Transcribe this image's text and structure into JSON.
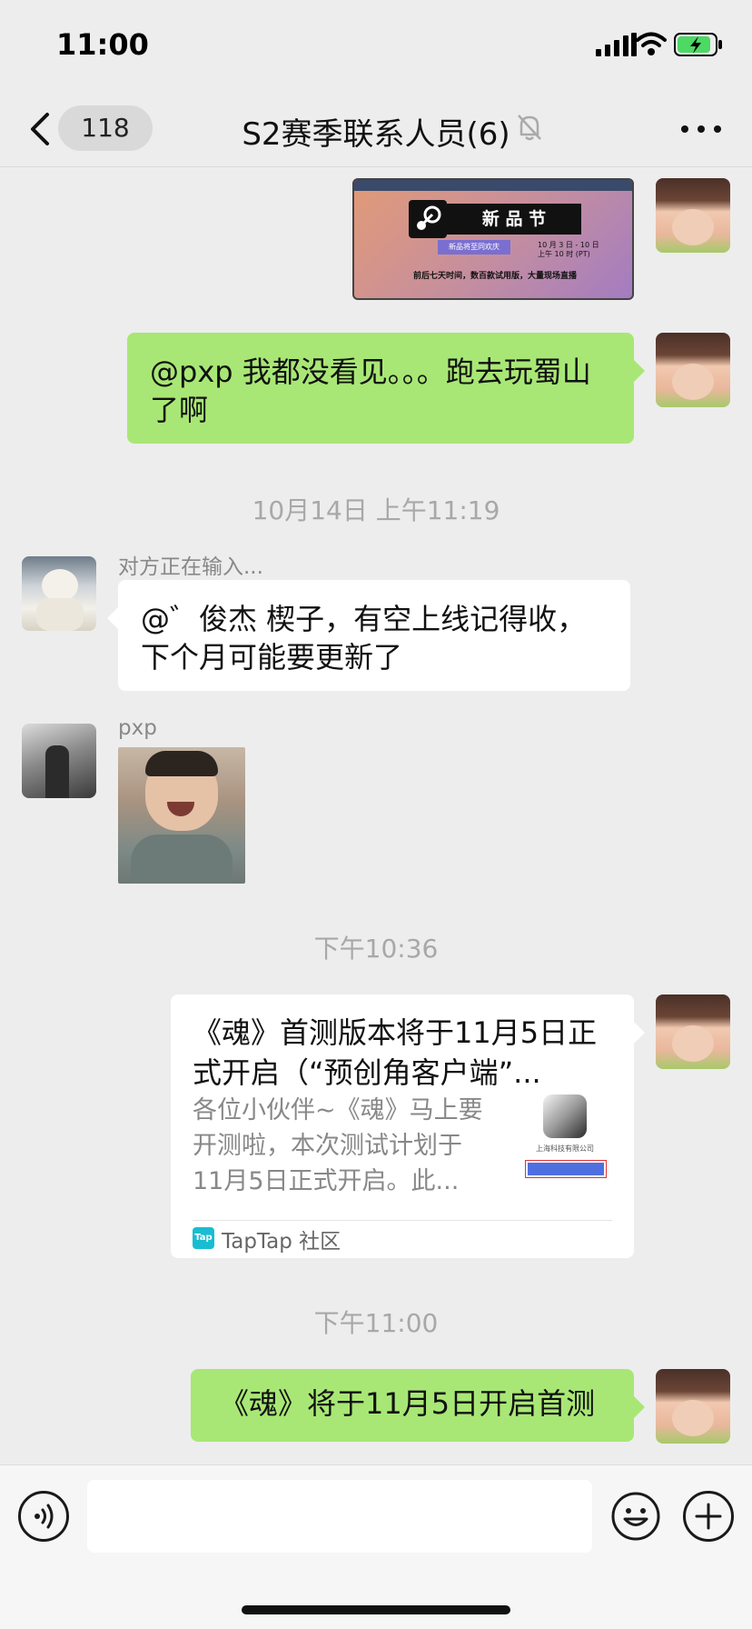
{
  "status_bar": {
    "time": "11:00"
  },
  "nav": {
    "unread_count": "118",
    "title": "S2赛季联系人员(6)"
  },
  "messages": {
    "steam_card": {
      "event_title": "新 品 节",
      "subtitle": "新品将至同欢庆",
      "dates": "10 月 3 日 - 10 日",
      "time": "上午 10 时 (PT)",
      "footer": "前后七天时间，数百款试用版，大量现场直播"
    },
    "msg1": {
      "text": "@pxp 我都没看见。。。跑去玩蜀山了啊"
    },
    "time1": "10月14日 上午11:19",
    "msg2": {
      "sender": "对方正在输入...",
      "text": "@゛俊杰 楔子，有空上线记得收，下个月可能要更新了"
    },
    "msg3": {
      "sender": "pxp"
    },
    "time2": "下午10:36",
    "link_card": {
      "title": "《魂》首测版本将于11月5日正式开启（“预创角客户端”...",
      "description": "各位小伙伴~《魂》马上要开测啦，本次测试计划于11月5日正式开启。此...",
      "thumb_caption": "上海科技有限公司",
      "source_logo": "Tap",
      "source": "TapTap 社区"
    },
    "time3": "下午11:00",
    "msg4": {
      "text": "《魂》将于11月5日开启首测"
    }
  },
  "input_bar": {
    "value": ""
  },
  "colors": {
    "background": "#ededed",
    "bubble_self": "#a8e775",
    "bubble_other": "#ffffff",
    "time_label": "#a8a8a8"
  },
  "icons": [
    "signal-icon",
    "wifi-icon",
    "battery-icon",
    "back-chevron-icon",
    "mute-bell-icon",
    "more-icon",
    "voice-icon",
    "emoji-icon",
    "plus-icon"
  ]
}
